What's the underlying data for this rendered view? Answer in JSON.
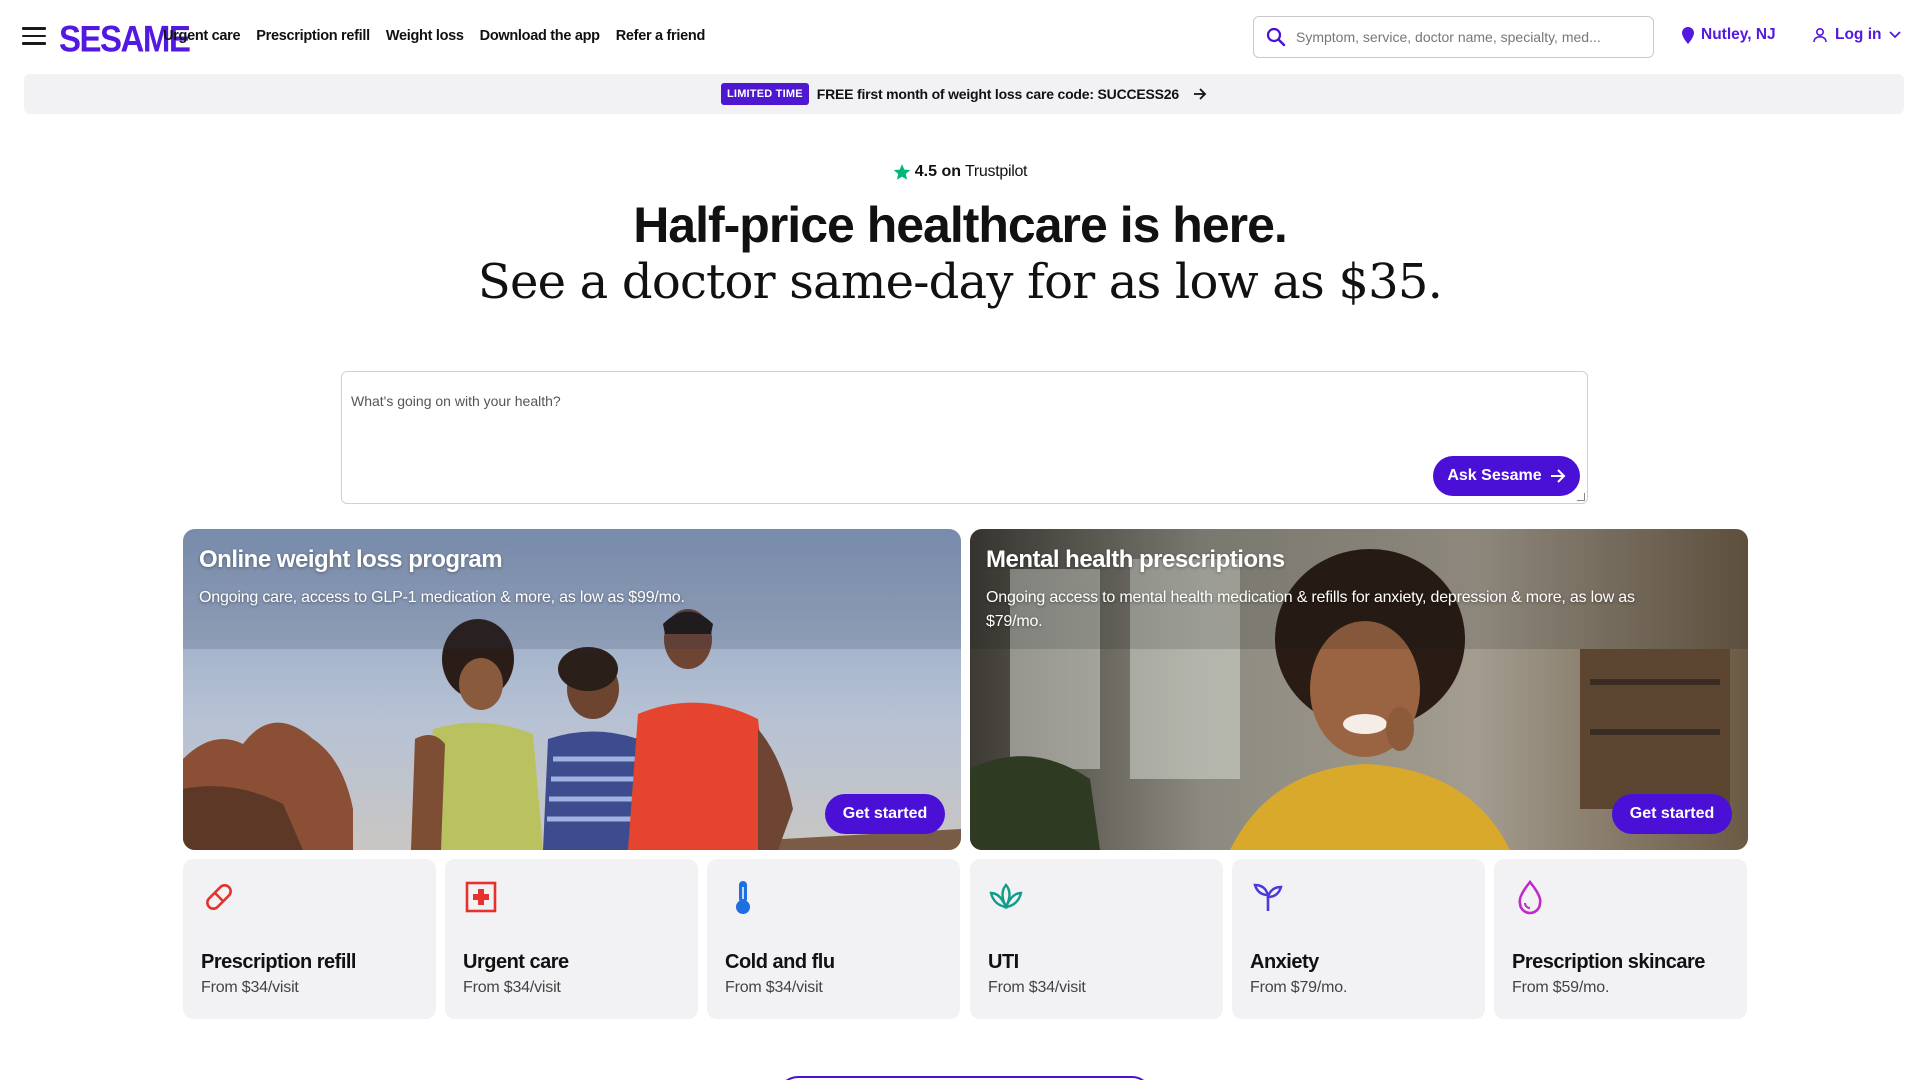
{
  "header": {
    "logo": "SESAME",
    "nav": [
      "Urgent care",
      "Prescription refill",
      "Weight loss",
      "Download the app",
      "Refer a friend"
    ],
    "search_placeholder": "Symptom, service, doctor name, specialty, med...",
    "location": "Nutley, NJ",
    "login": "Log in"
  },
  "promo": {
    "badge": "LIMITED TIME",
    "text": "FREE first month of weight loss care code: SUCCESS26"
  },
  "hero": {
    "rating": "4.5 on",
    "rating_source": "Trustpilot",
    "title": "Half-price healthcare is here.",
    "subtitle": "See a doctor same-day for as low as $35."
  },
  "ask": {
    "placeholder": "What's going on with your health?",
    "button": "Ask Sesame"
  },
  "features": [
    {
      "title": "Online weight loss program",
      "description": "Ongoing care, access to GLP-1 medication & more, as low as $99/mo.",
      "button": "Get started"
    },
    {
      "title": "Mental health prescriptions",
      "description": "Ongoing access to mental health medication & refills for anxiety, depression & more, as low as $79/mo.",
      "button": "Get started"
    }
  ],
  "services": [
    {
      "name": "Prescription refill",
      "price": "From $34/visit",
      "icon": "pill-icon",
      "color": "#e5322d"
    },
    {
      "name": "Urgent care",
      "price": "From $34/visit",
      "icon": "first-aid-icon",
      "color": "#e5322d"
    },
    {
      "name": "Cold and flu",
      "price": "From $34/visit",
      "icon": "thermometer-icon",
      "color": "#1e6fe0"
    },
    {
      "name": "UTI",
      "price": "From $34/visit",
      "icon": "lotus-icon",
      "color": "#0f9d8a"
    },
    {
      "name": "Anxiety",
      "price": "From $79/mo.",
      "icon": "sprout-icon",
      "color": "#4a3ad8"
    },
    {
      "name": "Prescription skincare",
      "price": "From $59/mo.",
      "icon": "droplet-icon",
      "color": "#c229c9"
    }
  ],
  "colors": {
    "brand": "#5319e0",
    "button": "#4a10d6",
    "tile_bg": "#f2f2f4",
    "trustpilot_star": "#00b67a"
  }
}
